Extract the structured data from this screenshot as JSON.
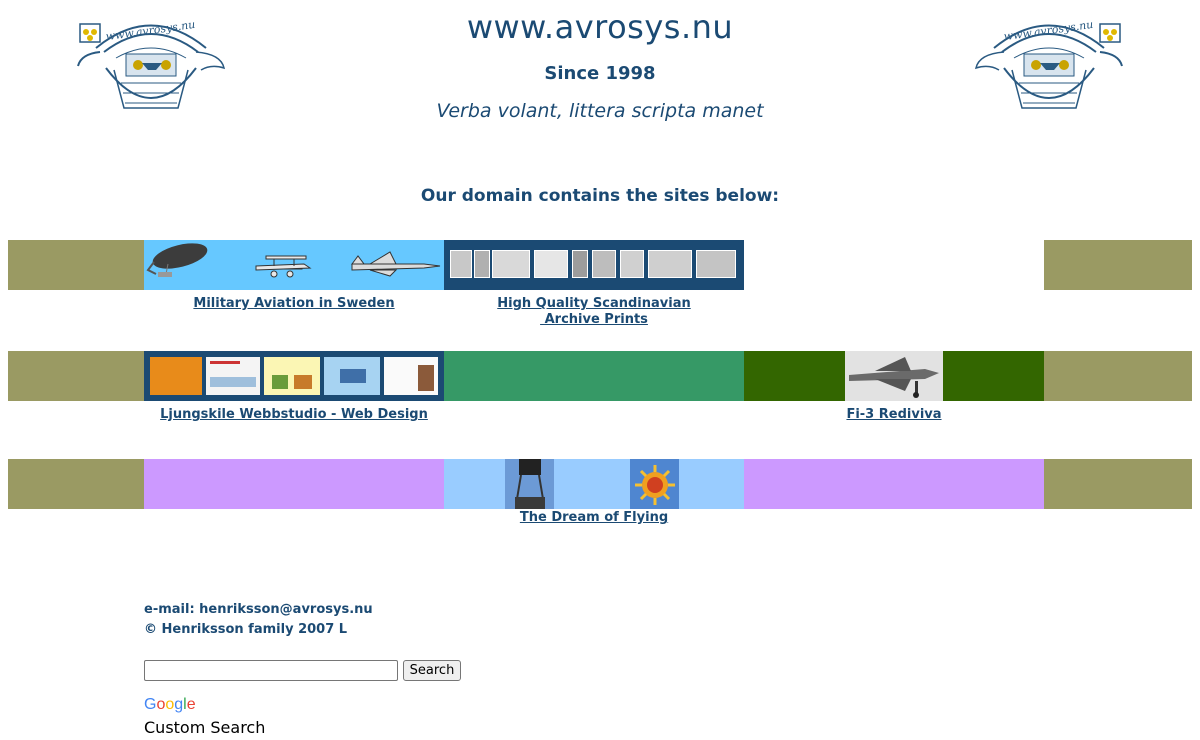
{
  "header": {
    "title": "www.avrosys.nu",
    "since": "Since 1998",
    "motto": "Verba volant, littera scripta manet",
    "logo_text": "www.avrosys.nu"
  },
  "intro": "Our domain contains the sites below:",
  "sites": {
    "military_aviation": "Military Aviation in Sweden",
    "archive_prints_line1": "High Quality Scandinavian",
    "archive_prints_line2": " Archive Prints",
    "webbstudio": "Ljungskile Webbstudio - Web Design",
    "fi3": "Fi-3 Rediviva",
    "dream_of_flying": "The Dream of Flying"
  },
  "footer": {
    "email": "e-mail: henriksson@avrosys.nu",
    "copyright": "© Henriksson family 2007 L"
  },
  "search": {
    "placeholder": "",
    "button_label": "Search",
    "google_letters": [
      "G",
      "o",
      "o",
      "g",
      "l",
      "e"
    ],
    "custom_search_label": "Custom Search"
  },
  "colors": {
    "olive": "#9a9a63",
    "sky": "#66c8ff",
    "navy": "#1b4a73",
    "green": "#369966",
    "dark_green": "#336600",
    "lilac": "#cc99ff",
    "pale_blue": "#99ccff"
  }
}
